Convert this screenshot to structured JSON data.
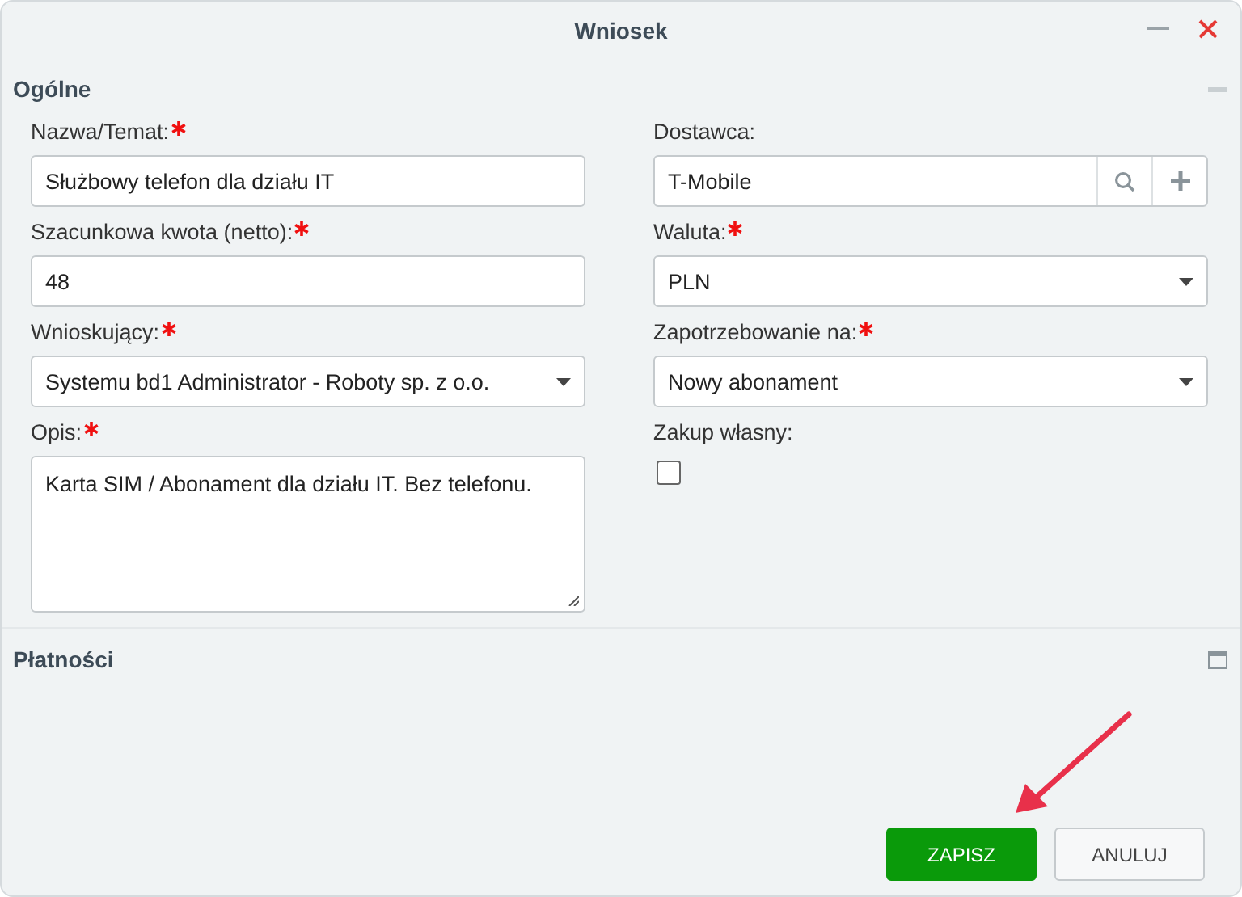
{
  "window": {
    "title": "Wniosek"
  },
  "sections": [
    {
      "title": "Ogólne",
      "expanded": true,
      "fields": [
        {
          "kind": "text",
          "label": "Nazwa/Temat:",
          "required": true,
          "value": "Służbowy telefon dla działu IT"
        },
        {
          "kind": "lookup",
          "label": "Dostawca:",
          "required": false,
          "value": "T-Mobile"
        },
        {
          "kind": "text",
          "label": "Szacunkowa kwota (netto):",
          "required": true,
          "value": "48"
        },
        {
          "kind": "select",
          "label": "Waluta:",
          "required": true,
          "value": "PLN"
        },
        {
          "kind": "select",
          "label": "Wnioskujący:",
          "required": true,
          "value": "Systemu bd1 Administrator - Roboty sp. z o.o."
        },
        {
          "kind": "select",
          "label": "Zapotrzebowanie na:",
          "required": true,
          "value": "Nowy abonament"
        },
        {
          "kind": "textarea",
          "label": "Opis:",
          "required": true,
          "value": "Karta SIM / Abonament dla działu IT. Bez telefonu."
        },
        {
          "kind": "checkbox",
          "label": "Zakup własny:",
          "required": false,
          "checked": false
        }
      ]
    },
    {
      "title": "Płatności",
      "expanded": false
    }
  ],
  "buttons": [
    {
      "label": "ZAPISZ",
      "kind": "primary"
    },
    {
      "label": "ANULUJ",
      "kind": "secondary"
    }
  ]
}
